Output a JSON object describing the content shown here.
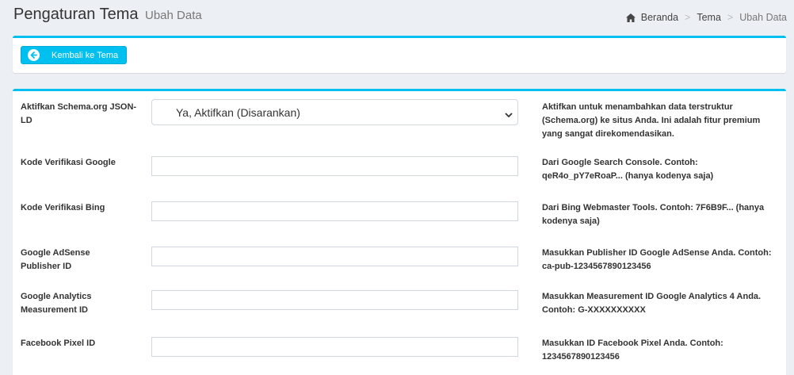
{
  "header": {
    "title": "Pengaturan Tema",
    "subtitle": "Ubah Data",
    "breadcrumb": [
      "Beranda",
      "Tema",
      "Ubah Data"
    ]
  },
  "toolbar": {
    "back_label": "Kembali ke Tema"
  },
  "colors": {
    "accent": "#00c0ef",
    "background": "#ecf0f5"
  },
  "form": {
    "schema": {
      "label": "Aktifkan Schema.org JSON-LD",
      "value": "Ya, Aktifkan (Disarankan)",
      "help": "Aktifkan untuk menambahkan data terstruktur (Schema.org) ke situs Anda. Ini adalah fitur premium yang sangat direkomendasikan."
    },
    "google_verification": {
      "label": "Kode Verifikasi Google",
      "value": "",
      "help": "Dari Google Search Console. Contoh: qeR4o_pY7eRoaP... (hanya kodenya saja)"
    },
    "bing_verification": {
      "label": "Kode Verifikasi Bing",
      "value": "",
      "help": "Dari Bing Webmaster Tools. Contoh: 7F6B9F... (hanya kodenya saja)"
    },
    "adsense": {
      "label": "Google AdSense Publisher ID",
      "value": "",
      "help": "Masukkan Publisher ID Google AdSense Anda. Contoh: ca-pub-1234567890123456"
    },
    "analytics": {
      "label": "Google Analytics Measurement ID",
      "value": "",
      "help": "Masukkan Measurement ID Google Analytics 4 Anda. Contoh: G-XXXXXXXXXX"
    },
    "facebook_pixel": {
      "label": "Facebook Pixel ID",
      "value": "",
      "help": "Masukkan ID Facebook Pixel Anda. Contoh: 1234567890123456"
    }
  }
}
